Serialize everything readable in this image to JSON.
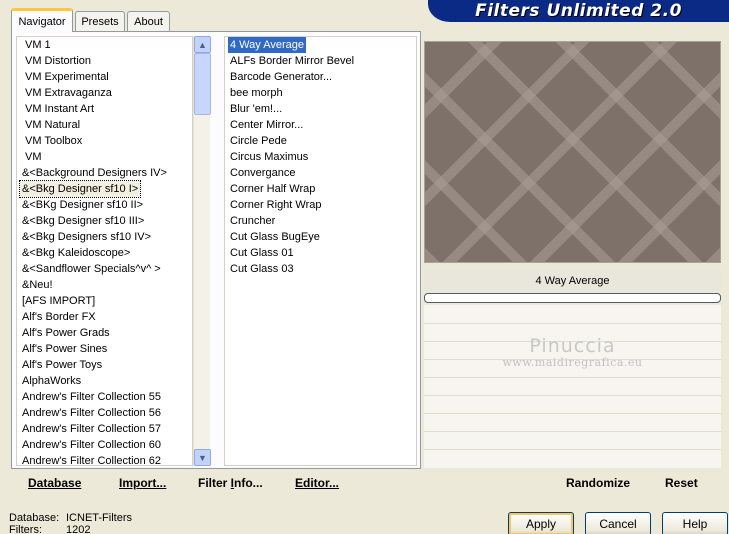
{
  "banner": {
    "title": "Filters Unlimited 2.0"
  },
  "tabs": [
    {
      "label": "Navigator",
      "active": true
    },
    {
      "label": "Presets",
      "active": false
    },
    {
      "label": "About",
      "active": false
    }
  ],
  "categories": {
    "items": [
      "VM 1",
      "VM Distortion",
      "VM Experimental",
      "VM Extravaganza",
      "VM Instant Art",
      "VM Natural",
      "VM Toolbox",
      "VM",
      "&<Background Designers IV>",
      "&<Bkg Designer sf10 I>",
      "&<BKg Designer sf10 II>",
      "&<Bkg Designer sf10 III>",
      "&<Bkg Designers sf10 IV>",
      "&<Bkg Kaleidoscope>",
      "&<Sandflower Specials^v^ >",
      "&Neu!",
      "[AFS IMPORT]",
      "Alf's Border FX",
      "Alf's Power Grads",
      "Alf's Power Sines",
      "Alf's Power Toys",
      "AlphaWorks",
      "Andrew's Filter Collection 55",
      "Andrew's Filter Collection 56",
      "Andrew's Filter Collection 57",
      "Andrew's Filter Collection 60",
      "Andrew's Filter Collection 62"
    ],
    "selected_index": 9
  },
  "filters": {
    "items": [
      "4 Way Average",
      "ALFs Border Mirror Bevel",
      "Barcode Generator...",
      "bee morph",
      "Blur 'em!...",
      "Center Mirror...",
      "Circle Pede",
      "Circus Maximus",
      "Convergance",
      "Corner Half Wrap",
      "Corner Right Wrap",
      "Cruncher",
      "Cut Glass  BugEye",
      "Cut Glass 01",
      "Cut Glass 03"
    ],
    "selected_index": 0
  },
  "preview": {
    "filter_name": "4 Way Average",
    "progress_percent": 0,
    "watermark": "Pinuccia",
    "watermark_url": "www.maidiregrafica.eu"
  },
  "toolbar": {
    "database": {
      "ul": "D",
      "rest": "atabase"
    },
    "import": {
      "ul": "I",
      "rest": "mport..."
    },
    "filter_info": {
      "pre": "Filter ",
      "ul": "I",
      "rest": "nfo..."
    },
    "editor": {
      "ul": "E",
      "rest": "ditor..."
    },
    "randomize": "Randomize",
    "reset": "Reset"
  },
  "footer": {
    "database_label": "Database:",
    "database_value": "ICNET-Filters",
    "filters_label": "Filters:",
    "filters_value": "1202"
  },
  "dialog": {
    "apply": "Apply",
    "cancel": "Cancel",
    "help": "Help"
  },
  "colors": {
    "accent": "#316ac5",
    "banner": "#0a2a86",
    "tab_highlight": "#ffc83c"
  }
}
